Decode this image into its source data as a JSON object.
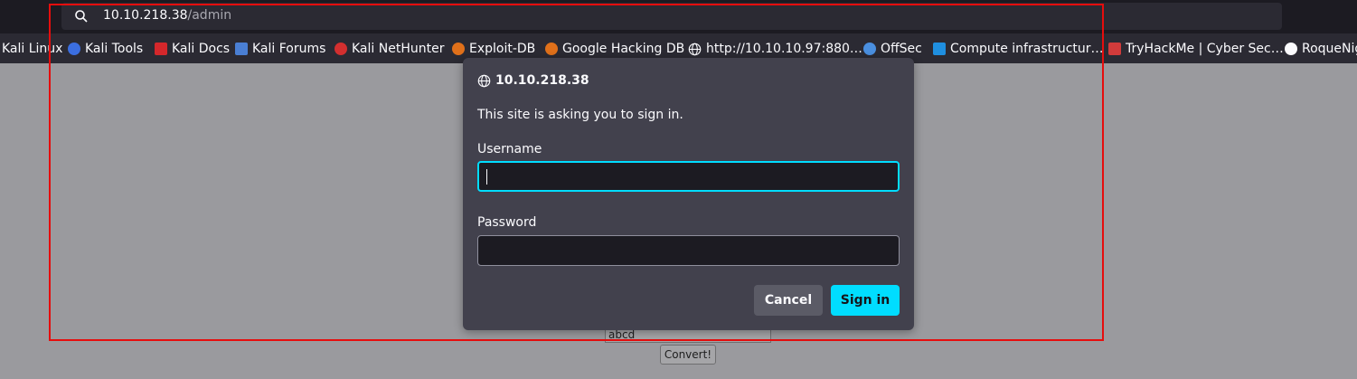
{
  "browser": {
    "url_host": "10.10.218.38",
    "url_path": "/admin",
    "search_icon": "search-icon",
    "bookmarks": [
      {
        "label": "Kali Linux",
        "icon": "kali-icon",
        "color": "#2b2a33"
      },
      {
        "label": "Kali Tools",
        "icon": "kali-tools-icon",
        "color": "#3b6ee0"
      },
      {
        "label": "Kali Docs",
        "icon": "kali-docs-icon",
        "color": "#d4272b"
      },
      {
        "label": "Kali Forums",
        "icon": "kali-forums-icon",
        "color": "#4a7fd4"
      },
      {
        "label": "Kali NetHunter",
        "icon": "nethunter-icon",
        "color": "#d32f2f"
      },
      {
        "label": "Exploit-DB",
        "icon": "exploit-db-icon",
        "color": "#e0701a"
      },
      {
        "label": "Google Hacking DB",
        "icon": "ghdb-icon",
        "color": "#e0701a"
      },
      {
        "label": "http://10.10.10.97:880…",
        "icon": "globe-icon",
        "color": "#fbfbfe"
      },
      {
        "label": "OffSec",
        "icon": "offsec-icon",
        "color": "#4a8fe0"
      },
      {
        "label": "Compute infrastructur…",
        "icon": "azure-icon",
        "color": "#1f8fe0"
      },
      {
        "label": "TryHackMe | Cyber Sec…",
        "icon": "tryhackme-icon",
        "color": "#d23b3b"
      },
      {
        "label": "RoqueNig",
        "icon": "github-icon",
        "color": "#fbfbfe"
      }
    ]
  },
  "page": {
    "input_value": "abcd",
    "convert_label": "Convert!"
  },
  "dialog": {
    "host": "10.10.218.38",
    "message": "This site is asking you to sign in.",
    "username_label": "Username",
    "username_value": "",
    "password_label": "Password",
    "password_value": "",
    "cancel_label": "Cancel",
    "signin_label": "Sign in",
    "accent_color": "#00ddff"
  },
  "annotation_color": "#e60d0d"
}
